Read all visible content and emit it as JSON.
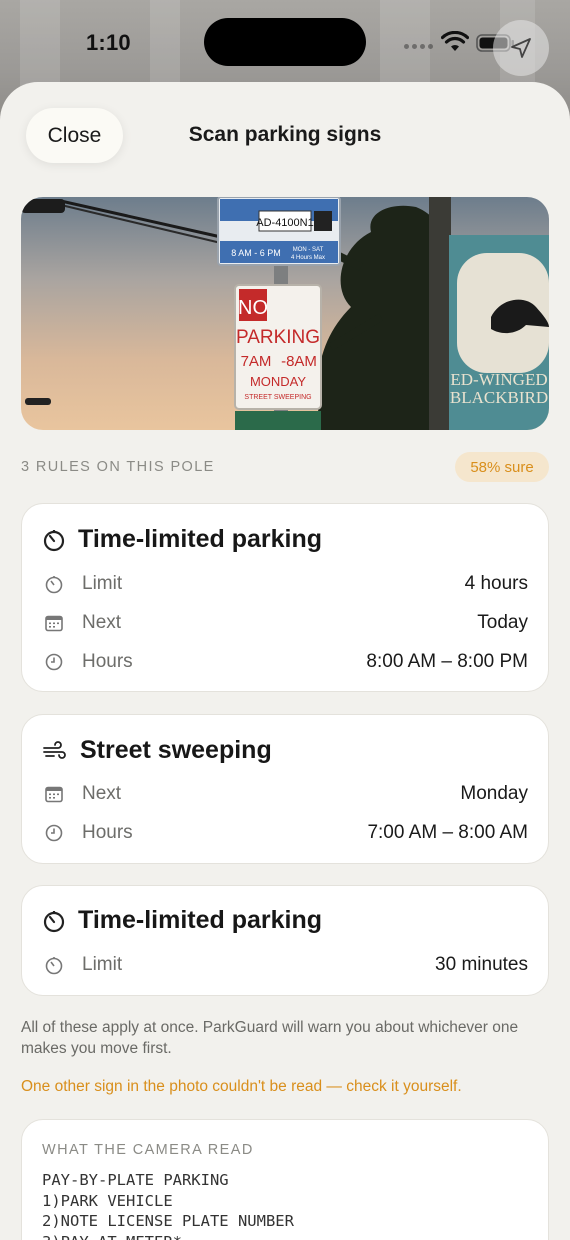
{
  "status_bar": {
    "time": "1:10",
    "icons": [
      "signal-dots-icon",
      "wifi-icon",
      "battery-icon",
      "location-arrow-icon"
    ]
  },
  "header": {
    "close_label": "Close",
    "title": "Scan parking signs"
  },
  "photo": {
    "sign_texts": [
      "AD-4100N1",
      "8 AM - 6 PM",
      "MON - SAT",
      "4 Hours Max",
      "NO",
      "PARKING",
      "7AM",
      "-8AM",
      "MONDAY",
      "STREET SWEEPING",
      "ED-WINGED",
      "BLACKBIRD"
    ]
  },
  "rules_summary": {
    "count_label": "3 RULES ON THIS POLE",
    "confidence": "58% sure"
  },
  "rules": [
    {
      "icon": "timer-icon",
      "title": "Time-limited parking",
      "rows": [
        {
          "icon": "timer-icon",
          "label": "Limit",
          "value": "4 hours"
        },
        {
          "icon": "calendar-icon",
          "label": "Next",
          "value": "Today"
        },
        {
          "icon": "clock-icon",
          "label": "Hours",
          "value": "8:00 AM – 8:00 PM"
        }
      ]
    },
    {
      "icon": "wind-icon",
      "title": "Street sweeping",
      "rows": [
        {
          "icon": "calendar-icon",
          "label": "Next",
          "value": "Monday"
        },
        {
          "icon": "clock-icon",
          "label": "Hours",
          "value": "7:00 AM – 8:00 AM"
        }
      ]
    },
    {
      "icon": "timer-icon",
      "title": "Time-limited parking",
      "rows": [
        {
          "icon": "timer-icon",
          "label": "Limit",
          "value": "30 minutes"
        }
      ]
    }
  ],
  "note": "All of these apply at once. ParkGuard will warn you about whichever one makes you move first.",
  "warning": "One other sign in the photo couldn't be read — check it yourself.",
  "camera_read": {
    "label": "WHAT THE CAMERA READ",
    "text": "PAY-BY-PLATE PARKING\n1)PARK VEHICLE\n2)NOTE LICENSE PLATE NUMBER\n3)PAY AT METER*"
  },
  "colors": {
    "accent": "#d98f1c",
    "sheet_bg": "#f2f1ed",
    "badge_bg": "#f5e6cd"
  }
}
